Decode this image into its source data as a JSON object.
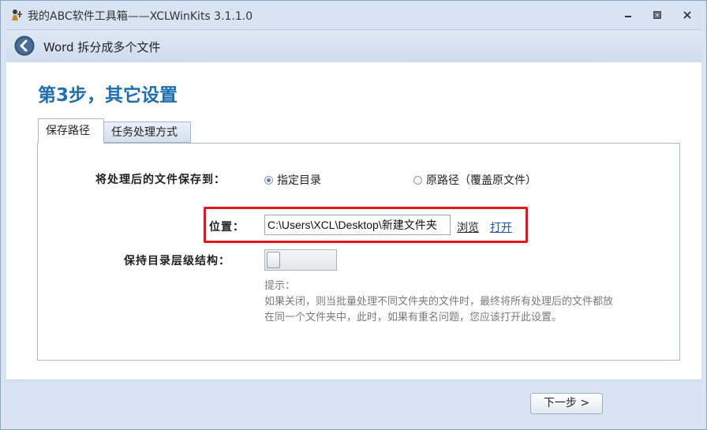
{
  "window": {
    "title": "我的ABC软件工具箱——XCLWinKits  3.1.1.0",
    "app_icon": "tools-person-icon",
    "controls": [
      "minimize-icon",
      "restore-icon",
      "close-icon"
    ]
  },
  "header": {
    "title": "Word 拆分成多个文件",
    "back_icon": "back-arrow-icon"
  },
  "main": {
    "step_prefix": "第",
    "step_number": "3",
    "step_suffix": "步，其它设置",
    "tabs": [
      {
        "label": "保存路径",
        "active": true
      },
      {
        "label": "任务处理方式",
        "active": false
      }
    ],
    "save_to_label": "将处理后的文件保存到：",
    "radio_options": [
      {
        "label": "指定目录",
        "selected": true
      },
      {
        "label": "原路径（覆盖原文件）",
        "selected": false
      }
    ],
    "location_label": "位置：",
    "location_value": "C:\\Users\\XCL\\Desktop\\新建文件夹",
    "browse_link": "浏览",
    "open_link": "打开",
    "keep_structure_label": "保持目录层级结构：",
    "keep_structure_on": false,
    "hint_title": "提示：",
    "hint_line1": "如果关闭，则当批量处理不同文件夹的文件时，最终将所有处理后的文件都放",
    "hint_line2": "在同一个文件夹中，此时，如果有重名问题，您应该打开此设置。"
  },
  "footer": {
    "next_label": "下一步 >"
  },
  "colors": {
    "accent": "#1e6fae",
    "highlight": "#e8141b",
    "link": "#1a55a8",
    "chrome": "#d9e4f3"
  }
}
